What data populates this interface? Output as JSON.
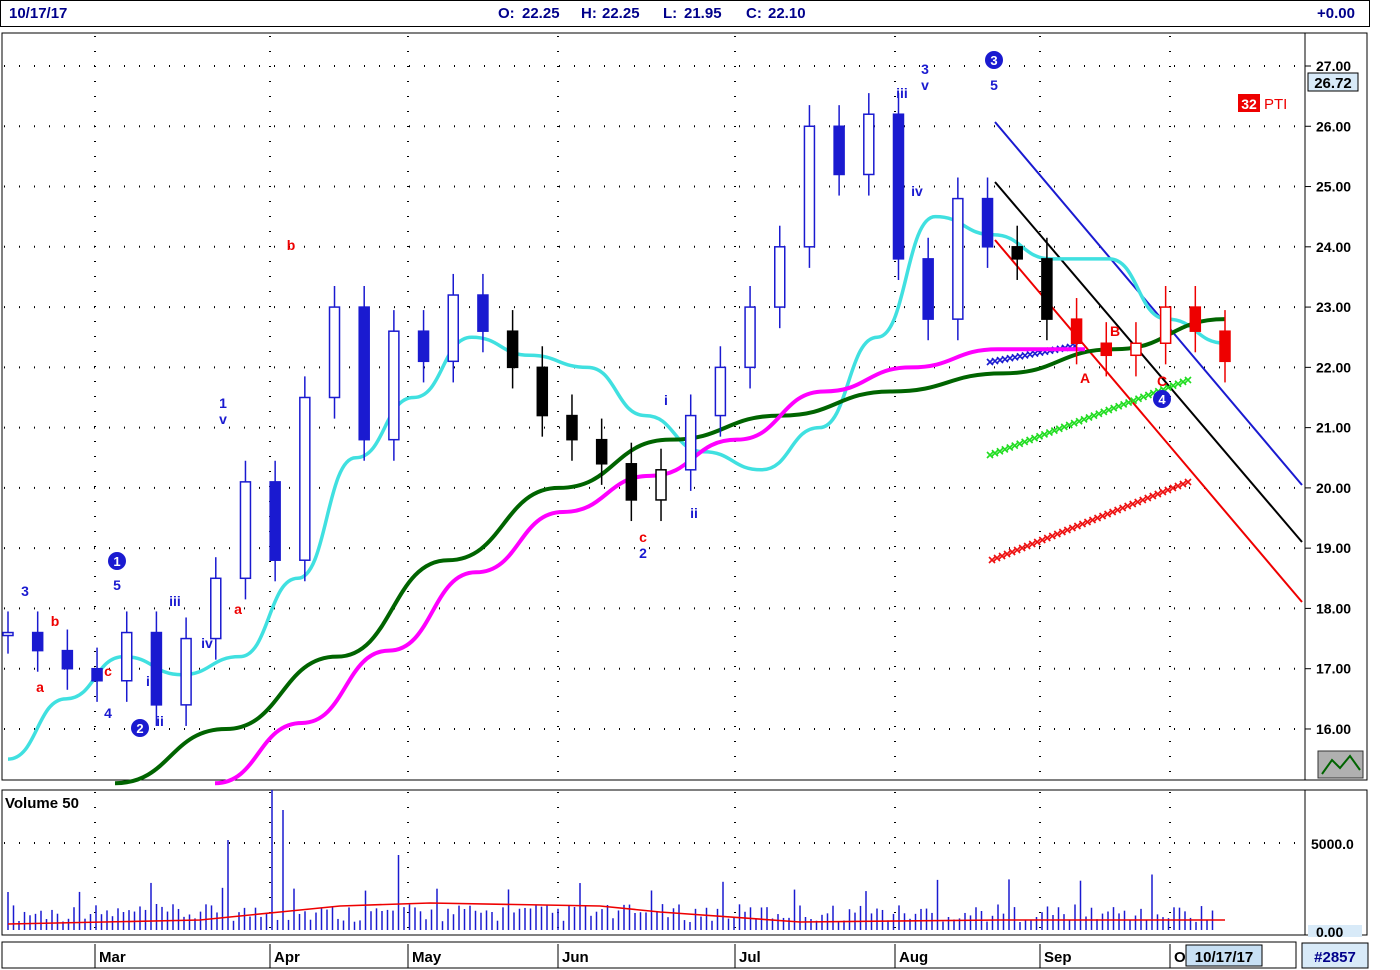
{
  "header": {
    "date": "10/17/17",
    "open_label": "O:",
    "open": "22.25",
    "high_label": "H:",
    "high": "22.25",
    "low_label": "L:",
    "low": "21.95",
    "close_label": "C:",
    "close": "22.10",
    "change": "+0.00"
  },
  "price_panel": {
    "last_price": "26.72",
    "badge_count": "32",
    "badge_label": "PTI",
    "y_ticks": [
      "27.00",
      "26.00",
      "25.00",
      "24.00",
      "23.00",
      "22.00",
      "21.00",
      "20.00",
      "19.00",
      "18.00",
      "17.00",
      "16.00"
    ]
  },
  "volume_panel": {
    "title": "Volume 50",
    "y_ticks": [
      "5000.0",
      "0.00"
    ]
  },
  "footer": {
    "months": [
      "Mar",
      "Apr",
      "May",
      "Jun",
      "Jul",
      "Aug",
      "Sep",
      "O"
    ],
    "cursor_date": "10/17/17",
    "symbol_number": "#2857"
  },
  "wave_labels": [
    {
      "text": "3",
      "color": "blue"
    },
    {
      "text": "a",
      "color": "red"
    },
    {
      "text": "b",
      "color": "red"
    },
    {
      "text": "1",
      "color": "blue-circle"
    },
    {
      "text": "5",
      "color": "blue"
    },
    {
      "text": "c",
      "color": "red"
    },
    {
      "text": "4",
      "color": "blue"
    },
    {
      "text": "2",
      "color": "blue-circle"
    },
    {
      "text": "i",
      "color": "blue"
    },
    {
      "text": "ii",
      "color": "blue"
    },
    {
      "text": "iii",
      "color": "blue"
    },
    {
      "text": "iv",
      "color": "blue"
    },
    {
      "text": "1",
      "color": "blue"
    },
    {
      "text": "v",
      "color": "blue"
    },
    {
      "text": "a",
      "color": "red"
    },
    {
      "text": "b",
      "color": "red"
    },
    {
      "text": "c",
      "color": "red"
    },
    {
      "text": "2",
      "color": "blue"
    },
    {
      "text": "i",
      "color": "blue"
    },
    {
      "text": "ii",
      "color": "blue"
    },
    {
      "text": "iii",
      "color": "blue"
    },
    {
      "text": "3",
      "color": "blue"
    },
    {
      "text": "v",
      "color": "blue"
    },
    {
      "text": "iv",
      "color": "blue"
    },
    {
      "text": "3",
      "color": "blue-circle"
    },
    {
      "text": "5",
      "color": "blue"
    },
    {
      "text": "A",
      "color": "red"
    },
    {
      "text": "B",
      "color": "red"
    },
    {
      "text": "C",
      "color": "red"
    },
    {
      "text": "4",
      "color": "blue-circle"
    }
  ],
  "chart_data": {
    "type": "candlestick",
    "title": "",
    "x_months": [
      "Mar",
      "Apr",
      "May",
      "Jun",
      "Jul",
      "Aug",
      "Sep",
      "Oct"
    ],
    "ylim": [
      15.2,
      27.5
    ],
    "grid": true,
    "last_price": 26.72,
    "ohlc_close_path": [
      {
        "date": "Feb-17",
        "close": 17.6
      },
      {
        "date": "Feb-24",
        "close": 17.3
      },
      {
        "date": "Mar-03",
        "close": 17.0
      },
      {
        "date": "Mar-10",
        "close": 16.8
      },
      {
        "date": "Mar-17",
        "close": 17.6
      },
      {
        "date": "Mar-24",
        "close": 16.4
      },
      {
        "date": "Mar-31",
        "close": 17.5
      },
      {
        "date": "Apr-05",
        "close": 18.5
      },
      {
        "date": "Apr-07",
        "close": 20.1
      },
      {
        "date": "Apr-12",
        "close": 18.8
      },
      {
        "date": "Apr-18",
        "close": 21.5
      },
      {
        "date": "Apr-21",
        "close": 23.0
      },
      {
        "date": "Apr-26",
        "close": 20.8
      },
      {
        "date": "May-03",
        "close": 22.6
      },
      {
        "date": "May-08",
        "close": 22.1
      },
      {
        "date": "May-15",
        "close": 23.2
      },
      {
        "date": "May-22",
        "close": 22.6
      },
      {
        "date": "May-31",
        "close": 22.0
      },
      {
        "date": "Jun-07",
        "close": 21.2
      },
      {
        "date": "Jun-14",
        "close": 20.8
      },
      {
        "date": "Jun-21",
        "close": 20.4
      },
      {
        "date": "Jun-28",
        "close": 19.8
      },
      {
        "date": "Jul-05",
        "close": 20.3
      },
      {
        "date": "Jul-12",
        "close": 21.2
      },
      {
        "date": "Jul-19",
        "close": 22.0
      },
      {
        "date": "Jul-26",
        "close": 23.0
      },
      {
        "date": "Aug-01",
        "close": 24.0
      },
      {
        "date": "Aug-04",
        "close": 26.0
      },
      {
        "date": "Aug-08",
        "close": 25.2
      },
      {
        "date": "Aug-11",
        "close": 26.2
      },
      {
        "date": "Aug-15",
        "close": 23.8
      },
      {
        "date": "Aug-18",
        "close": 22.8
      },
      {
        "date": "Aug-23",
        "close": 24.8
      },
      {
        "date": "Aug-29",
        "close": 24.0
      },
      {
        "date": "Sep-05",
        "close": 23.8
      },
      {
        "date": "Sep-08",
        "close": 22.8
      },
      {
        "date": "Sep-15",
        "close": 22.4
      },
      {
        "date": "Sep-22",
        "close": 22.2
      },
      {
        "date": "Sep-29",
        "close": 22.4
      },
      {
        "date": "Oct-06",
        "close": 23.0
      },
      {
        "date": "Oct-13",
        "close": 22.6
      },
      {
        "date": "Oct-17",
        "close": 22.1
      }
    ],
    "series": [
      {
        "name": "",
        "color": "#40e0e0",
        "values": [
          15.5,
          16.5,
          17.2,
          16.9,
          17.2,
          18.5,
          20.5,
          21.5,
          22.5,
          22.2,
          22.0,
          21.2,
          20.6,
          20.3,
          21.0,
          22.5,
          24.5,
          24.2,
          23.8,
          23.8,
          22.8,
          22.4
        ]
      },
      {
        "name": "",
        "color": "#006400",
        "values": [
          15.1,
          16.0,
          17.2,
          18.8,
          20.0,
          20.8,
          21.2,
          21.6,
          21.9,
          22.3,
          22.8
        ]
      },
      {
        "name": "",
        "color": "#ff00ff",
        "values": [
          15.1,
          16.1,
          17.3,
          18.6,
          19.6,
          20.2,
          20.8,
          21.6,
          22.0,
          22.3,
          22.3
        ]
      }
    ],
    "volume": {
      "ylim": [
        0,
        7000
      ],
      "ticks": [
        0,
        5000
      ]
    }
  }
}
